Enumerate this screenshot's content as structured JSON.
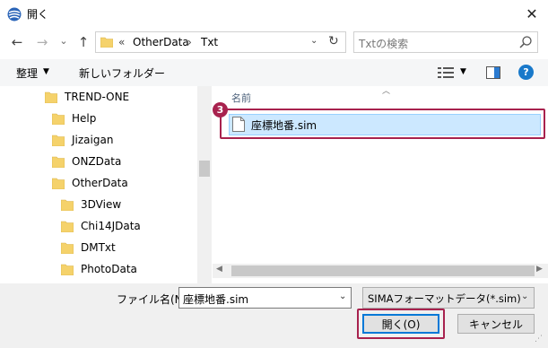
{
  "window": {
    "title": "開く",
    "close": "✕"
  },
  "nav": {
    "back": "←",
    "forward": "→",
    "recent": "⌄",
    "up": "↑",
    "address_prefix": "«",
    "breadcrumbs": [
      "OtherData",
      "Txt"
    ],
    "separator": "›",
    "refresh": "↻",
    "search_placeholder": "Txtの検索"
  },
  "toolbar": {
    "organize": "整理",
    "new_folder": "新しいフォルダー",
    "caret": "▼",
    "help": "?"
  },
  "tree": {
    "items": [
      {
        "label": "TREND-ONE",
        "level": 0
      },
      {
        "label": "Help",
        "level": 1
      },
      {
        "label": "Jizaigan",
        "level": 1
      },
      {
        "label": "ONZData",
        "level": 1
      },
      {
        "label": "OtherData",
        "level": 1
      },
      {
        "label": "3DView",
        "level": 2
      },
      {
        "label": "Chi14JData",
        "level": 2
      },
      {
        "label": "DMTxt",
        "level": 2
      },
      {
        "label": "PhotoData",
        "level": 2
      }
    ]
  },
  "filelist": {
    "column_header": "名前",
    "sort_caret": "︿",
    "files": [
      {
        "name": "座標地番.sim",
        "selected": true
      }
    ]
  },
  "annotation": {
    "badge": "3",
    "color": "#a8224e"
  },
  "bottom": {
    "filename_label": "ファイル名(N):",
    "filename_value": "座標地番.sim",
    "filetype_value": "SIMAフォーマットデータ(*.sim)",
    "open": "開く(O)",
    "cancel": "キャンセル",
    "caret": "⌄"
  },
  "colors": {
    "accent": "#0078d7",
    "selection": "#cce8ff",
    "folder": "#f5d26b",
    "help": "#1979ca"
  }
}
